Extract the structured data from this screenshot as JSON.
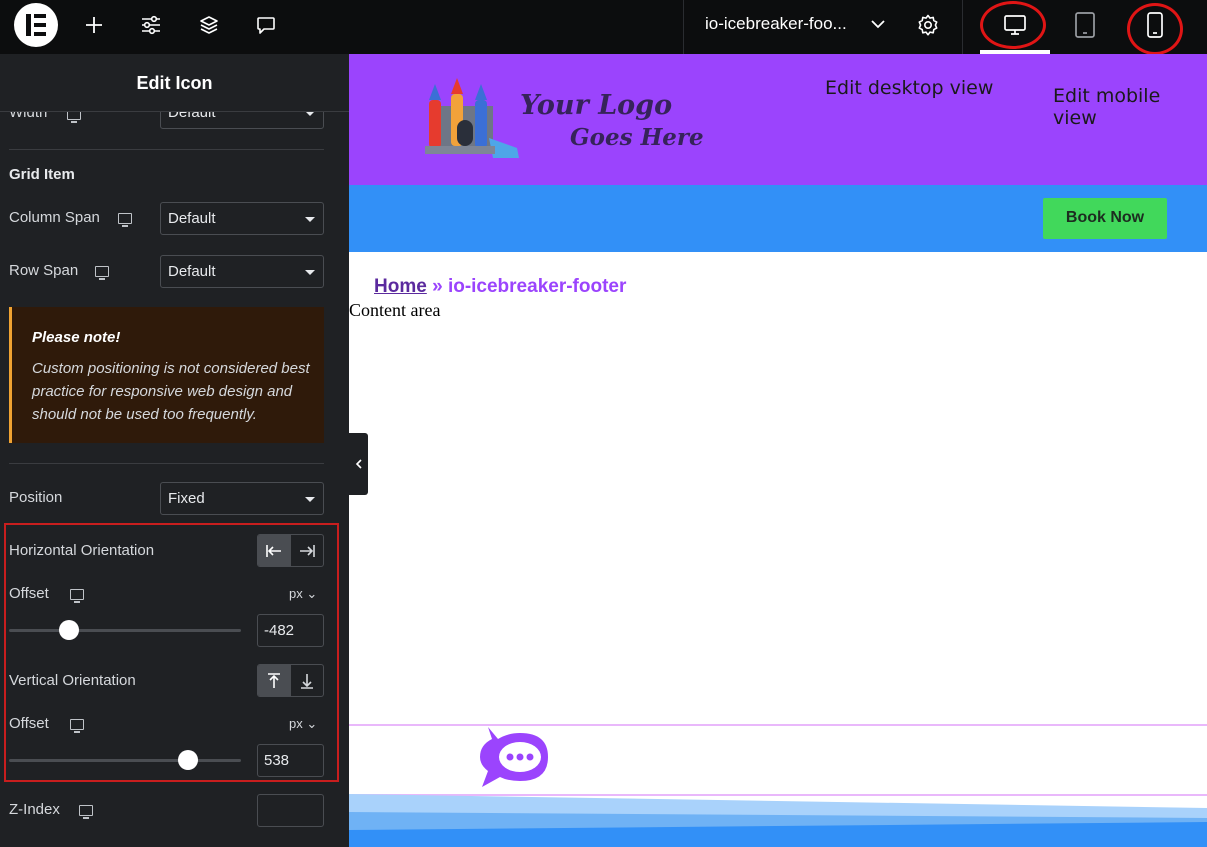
{
  "topbar": {
    "logo_icon": "elementor-logo-icon",
    "add_icon": "plus-icon",
    "settings_icon": "sliders-icon",
    "structure_icon": "layers-icon",
    "notes_icon": "comment-icon",
    "document_title": "io-icebreaker-foo...",
    "document_chevron_icon": "chevron-down-icon",
    "page_settings_icon": "gear-icon",
    "device_desktop_icon": "monitor-icon",
    "device_tablet_icon": "tablet-icon",
    "device_mobile_icon": "mobile-icon",
    "annotation_color": "#e01515"
  },
  "panel": {
    "title": "Edit Icon",
    "width_label": "Width",
    "width_value": "Default",
    "grid_item_heading": "Grid Item",
    "column_span_label": "Column Span",
    "column_span_value": "Default",
    "row_span_label": "Row Span",
    "row_span_value": "Default",
    "note_title": "Please note!",
    "note_body": "Custom positioning is not considered best practice for responsive web design and should not be used too frequently.",
    "position_label": "Position",
    "position_value": "Fixed",
    "horizontal_orientation_label": "Horizontal Orientation",
    "horizontal_orientation_selected": "left",
    "h_offset_label": "Offset",
    "h_offset_unit": "px",
    "h_offset_value": "-482",
    "h_offset_slider_fraction": 0.26,
    "vertical_orientation_label": "Vertical Orientation",
    "vertical_orientation_selected": "top",
    "v_offset_label": "Offset",
    "v_offset_unit": "px",
    "v_offset_value": "538",
    "v_offset_slider_fraction": 0.77,
    "z_index_label": "Z-Index",
    "z_index_value": ""
  },
  "preview": {
    "logo_line1": "Your Logo",
    "logo_line2": "Goes Here",
    "annotation_desktop": "Edit desktop view",
    "annotation_mobile": "Edit mobile view",
    "book_now": "Book Now",
    "breadcrumb_home": "Home",
    "breadcrumb_sep": "»",
    "breadcrumb_current": "io-icebreaker-footer",
    "content_area": "Content area",
    "chat_icon": "chat-bubble-icon",
    "colors": {
      "hero": "#9b44fd",
      "band": "#3290f7",
      "button": "#41d85b"
    }
  }
}
